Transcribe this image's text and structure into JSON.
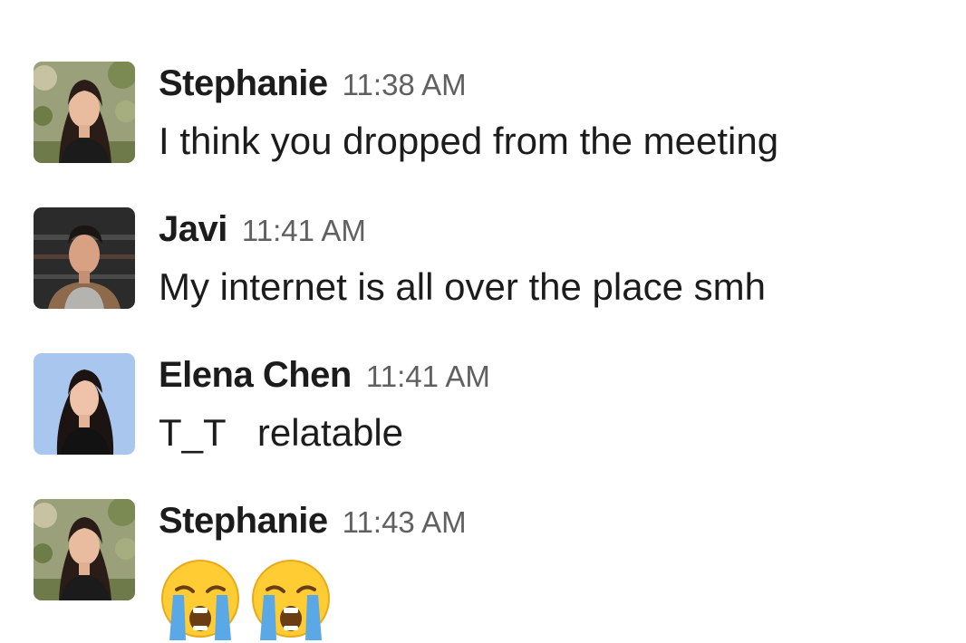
{
  "messages": [
    {
      "sender": "Stephanie",
      "time": "11:38 AM",
      "text": "I think you dropped from the meeting",
      "avatar_icon": "stephanie-avatar"
    },
    {
      "sender": "Javi",
      "time": "11:41 AM",
      "text": "My internet is all over the place smh",
      "avatar_icon": "javi-avatar"
    },
    {
      "sender": "Elena Chen",
      "time": "11:41 AM",
      "text": "T_T   relatable",
      "avatar_icon": "elena-avatar"
    },
    {
      "sender": "Stephanie",
      "time": "11:43 AM",
      "emojis": [
        "loudly-crying-face-icon",
        "loudly-crying-face-icon"
      ],
      "avatar_icon": "stephanie-avatar"
    }
  ],
  "colors": {
    "sender": "#1d1c1d",
    "timestamp": "#616061",
    "body_text": "#1d1c1d",
    "emoji_face": "#ffcc33",
    "emoji_tears": "#5aa9e6"
  }
}
